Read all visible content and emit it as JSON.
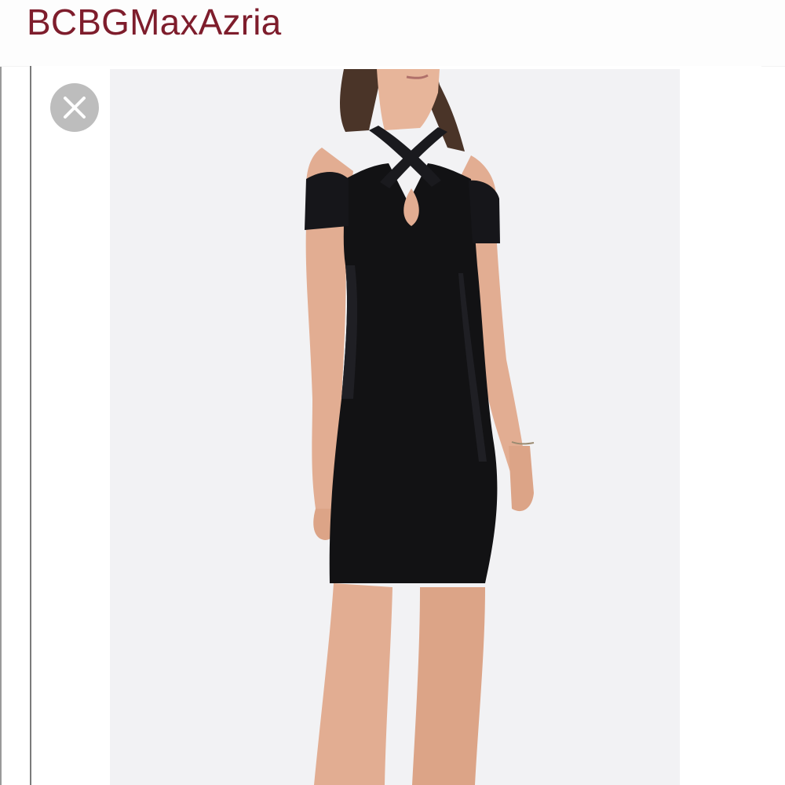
{
  "header": {
    "brand": "BCBGMaxAzria",
    "brand_color": "#7e1d2c"
  },
  "viewer": {
    "close_icon": "close-icon",
    "image_subject": "black-cutout-bodycon-dress-photo"
  }
}
